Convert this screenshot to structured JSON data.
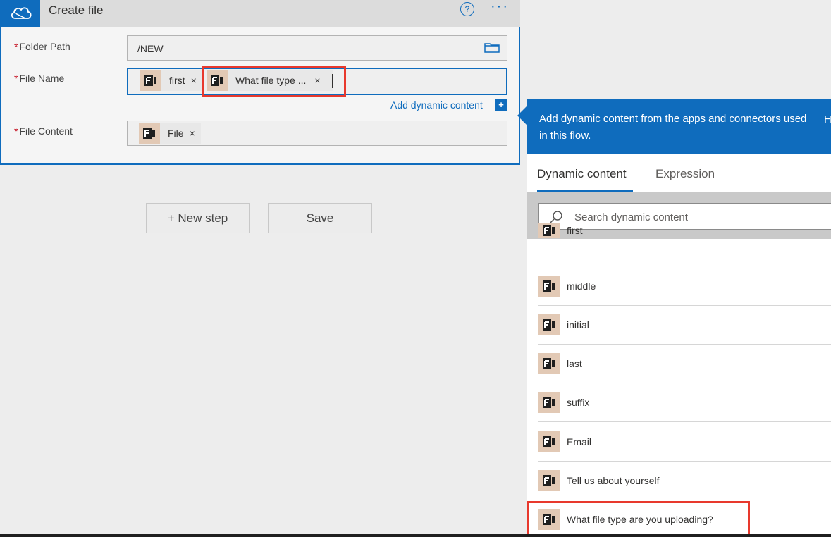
{
  "card": {
    "title": "Create file",
    "help_glyph": "?",
    "more_glyph": "···",
    "fields": {
      "folder_path": {
        "label": "Folder Path",
        "required_mark": "*",
        "value": "/NEW"
      },
      "file_name": {
        "label": "File Name",
        "required_mark": "*",
        "tokens": [
          {
            "label": "first",
            "close": "×"
          },
          {
            "label": "What file type ...",
            "close": "×"
          }
        ]
      },
      "file_content": {
        "label": "File Content",
        "required_mark": "*",
        "tokens": [
          {
            "label": "File",
            "close": "×"
          }
        ]
      }
    },
    "add_dynamic_content": "Add dynamic content",
    "add_dynamic_plus": "+"
  },
  "buttons": {
    "new_step": "+ New step",
    "save": "Save"
  },
  "panel": {
    "header_text": "Add dynamic content from the apps and connectors used in this flow.",
    "header_cut": "H",
    "tabs": [
      "Dynamic content",
      "Expression"
    ],
    "search_placeholder": "Search dynamic content",
    "items": [
      "first",
      "middle",
      "initial",
      "last",
      "suffix",
      "Email",
      "Tell us about yourself",
      "What file type are you uploading?"
    ]
  },
  "colors": {
    "accent": "#0f6cbd",
    "highlight": "#e8392d",
    "token_icon_bg": "#e2c9b5"
  }
}
